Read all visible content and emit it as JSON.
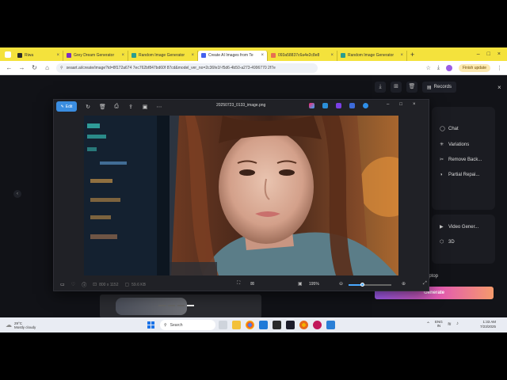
{
  "browser": {
    "tabs": [
      {
        "label": "Riwa",
        "color": "#2b2b2b",
        "active": false
      },
      {
        "label": "Grey Dream Generator",
        "color": "#7b2cbf",
        "active": false
      },
      {
        "label": "Random Image Generator",
        "color": "#2a9d8f",
        "active": false
      },
      {
        "label": "Create AI Images from Te",
        "color": "#4361ee",
        "active": true
      },
      {
        "label": "093a58837c6a4e2c8e8",
        "color": "#e76f51",
        "active": false
      },
      {
        "label": "Random Image Generator",
        "color": "#2a9d8f",
        "active": false
      }
    ],
    "new_tab": "+",
    "url": "seaart.ai/create/image?id=8f172a674 7ec762bf847bd60f 87cd&model_ver_no=2c36fe1f-f5d6-4b50-a273-4996770 2f7e",
    "finish_update": "Finish update"
  },
  "right_panel": {
    "records_label": "Records",
    "menu_top": [
      {
        "label": "Chat",
        "icon": "chat-icon"
      },
      {
        "label": "Variations",
        "icon": "variations-icon"
      },
      {
        "label": "Remove Back...",
        "icon": "remove-background-icon"
      },
      {
        "label": "Partial Repai...",
        "icon": "partial-repaint-icon"
      }
    ],
    "menu_bottom": [
      {
        "label": "Video Gener...",
        "icon": "video-icon"
      },
      {
        "label": "3D",
        "icon": "3d-icon"
      }
    ],
    "laptop_label": "aptop",
    "generate_label": "Generate"
  },
  "viewer": {
    "edit_label": "Edit",
    "filename": "20250723_0133_image.png",
    "dims": "800 x 1152",
    "size": "59.6 KB",
    "zoom": "195%",
    "zoom_fraction": 0.32
  },
  "taskbar": {
    "temperature": "29°C",
    "weather_desc": "Mostly cloudy",
    "search_placeholder": "Search",
    "lang": "ENG",
    "lang_region": "IN",
    "time": "1:33 AM",
    "date": "7/23/2025"
  }
}
